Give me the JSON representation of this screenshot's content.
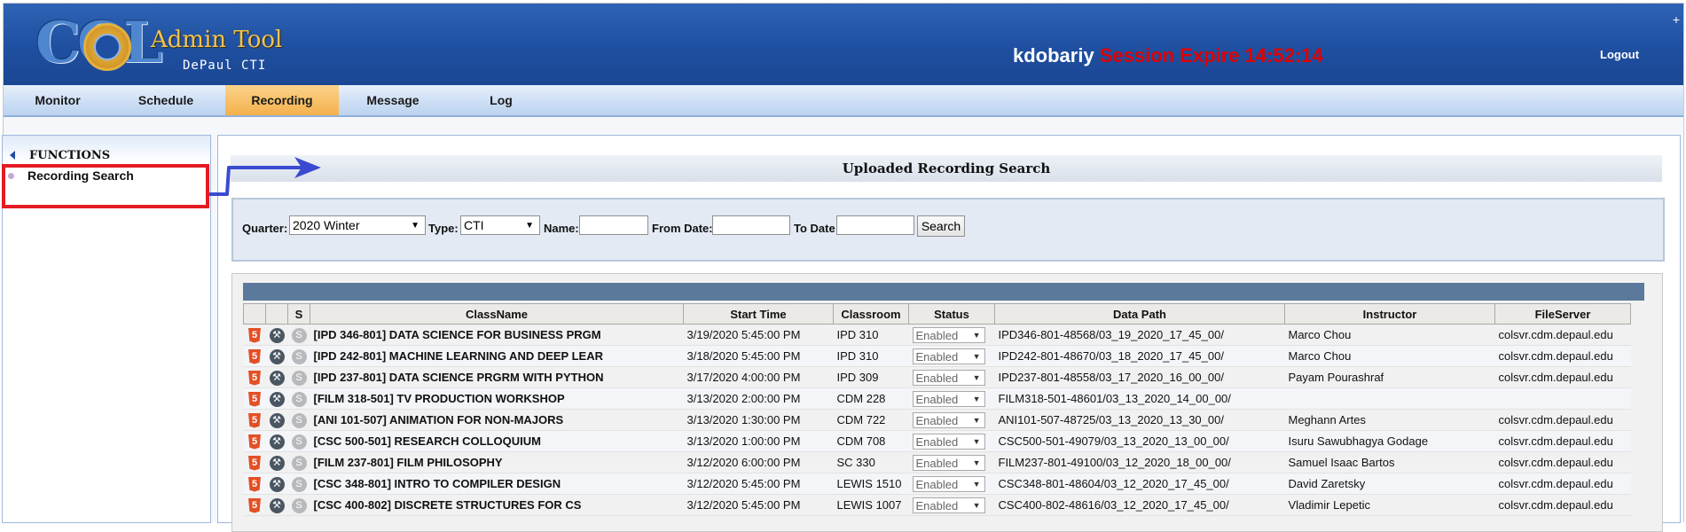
{
  "header": {
    "logo_text": "COL",
    "app_title": "Admin Tool",
    "app_subtitle": "DePaul CTI",
    "username": "kdobariy",
    "session_text": "Session Expire 14:52:14",
    "logout_label": "Logout"
  },
  "nav": {
    "items": [
      {
        "label": "Monitor"
      },
      {
        "label": "Schedule"
      },
      {
        "label": "Recording"
      },
      {
        "label": "Message"
      },
      {
        "label": "Log"
      }
    ],
    "active": "Recording"
  },
  "sidebar": {
    "title": "FUNCTIONS",
    "items": [
      {
        "label": "Recording Search"
      }
    ]
  },
  "main": {
    "title": "Uploaded Recording Search",
    "search": {
      "quarter_label": "Quarter:",
      "quarter_value": "2020 Winter",
      "type_label": "Type:",
      "type_value": "CTI",
      "name_label": "Name:",
      "name_value": "",
      "from_label": "From Date:",
      "from_value": "",
      "to_label": "To Date:",
      "to_value": "",
      "search_button": "Search"
    },
    "table": {
      "headers": [
        "",
        "",
        "S",
        "ClassName",
        "Start Time",
        "Classroom",
        "Status",
        "Data Path",
        "Instructor",
        "FileServer"
      ],
      "rows": [
        {
          "classname": "[IPD 346-801] DATA SCIENCE FOR BUSINESS PRGM",
          "start": "3/19/2020 5:45:00 PM",
          "room": "IPD 310",
          "status": "Enabled",
          "path": "IPD346-801-48568/03_19_2020_17_45_00/",
          "instructor": "Marco Chou",
          "server": "colsvr.cdm.depaul.edu"
        },
        {
          "classname": "[IPD 242-801] MACHINE LEARNING AND DEEP LEAR",
          "start": "3/18/2020 5:45:00 PM",
          "room": "IPD 310",
          "status": "Enabled",
          "path": "IPD242-801-48670/03_18_2020_17_45_00/",
          "instructor": "Marco Chou",
          "server": "colsvr.cdm.depaul.edu"
        },
        {
          "classname": "[IPD 237-801] DATA SCIENCE PRGRM WITH PYTHON",
          "start": "3/17/2020 4:00:00 PM",
          "room": "IPD 309",
          "status": "Enabled",
          "path": "IPD237-801-48558/03_17_2020_16_00_00/",
          "instructor": "Payam Pourashraf",
          "server": "colsvr.cdm.depaul.edu"
        },
        {
          "classname": "[FILM 318-501] TV PRODUCTION WORKSHOP",
          "start": "3/13/2020 2:00:00 PM",
          "room": "CDM 228",
          "status": "Enabled",
          "path": "FILM318-501-48601/03_13_2020_14_00_00/",
          "instructor": "",
          "server": ""
        },
        {
          "classname": "[ANI 101-507] ANIMATION FOR NON-MAJORS",
          "start": "3/13/2020 1:30:00 PM",
          "room": "CDM 722",
          "status": "Enabled",
          "path": "ANI101-507-48725/03_13_2020_13_30_00/",
          "instructor": "Meghann Artes",
          "server": "colsvr.cdm.depaul.edu"
        },
        {
          "classname": "[CSC 500-501] RESEARCH COLLOQUIUM",
          "start": "3/13/2020 1:00:00 PM",
          "room": "CDM 708",
          "status": "Enabled",
          "path": "CSC500-501-49079/03_13_2020_13_00_00/",
          "instructor": "Isuru Sawubhagya Godage",
          "server": "colsvr.cdm.depaul.edu"
        },
        {
          "classname": "[FILM 237-801] FILM PHILOSOPHY",
          "start": "3/12/2020 6:00:00 PM",
          "room": "SC 330",
          "status": "Enabled",
          "path": "FILM237-801-49100/03_12_2020_18_00_00/",
          "instructor": "Samuel Isaac Bartos",
          "server": "colsvr.cdm.depaul.edu"
        },
        {
          "classname": "[CSC 348-801] INTRO TO COMPILER DESIGN",
          "start": "3/12/2020 5:45:00 PM",
          "room": "LEWIS 1510",
          "status": "Enabled",
          "path": "CSC348-801-48604/03_12_2020_17_45_00/",
          "instructor": "David Zaretsky",
          "server": "colsvr.cdm.depaul.edu"
        },
        {
          "classname": "[CSC 400-802] DISCRETE STRUCTURES FOR CS",
          "start": "3/12/2020 5:45:00 PM",
          "room": "LEWIS 1007",
          "status": "Enabled",
          "path": "CSC400-802-48616/03_12_2020_17_45_00/",
          "instructor": "Vladimir Lepetic",
          "server": "colsvr.cdm.depaul.edu"
        }
      ]
    }
  },
  "icons": {
    "html5": "html5-icon",
    "edit": "wrench-icon",
    "s": "s-circle-icon",
    "dropdown": "chevron-down-icon"
  },
  "colors": {
    "header_bg": "#1f4fa0",
    "nav_active": "#f4b04c",
    "session_red": "#e00000",
    "highlight_box": "#e41b23",
    "arrow_blue": "#3b4bd0"
  }
}
